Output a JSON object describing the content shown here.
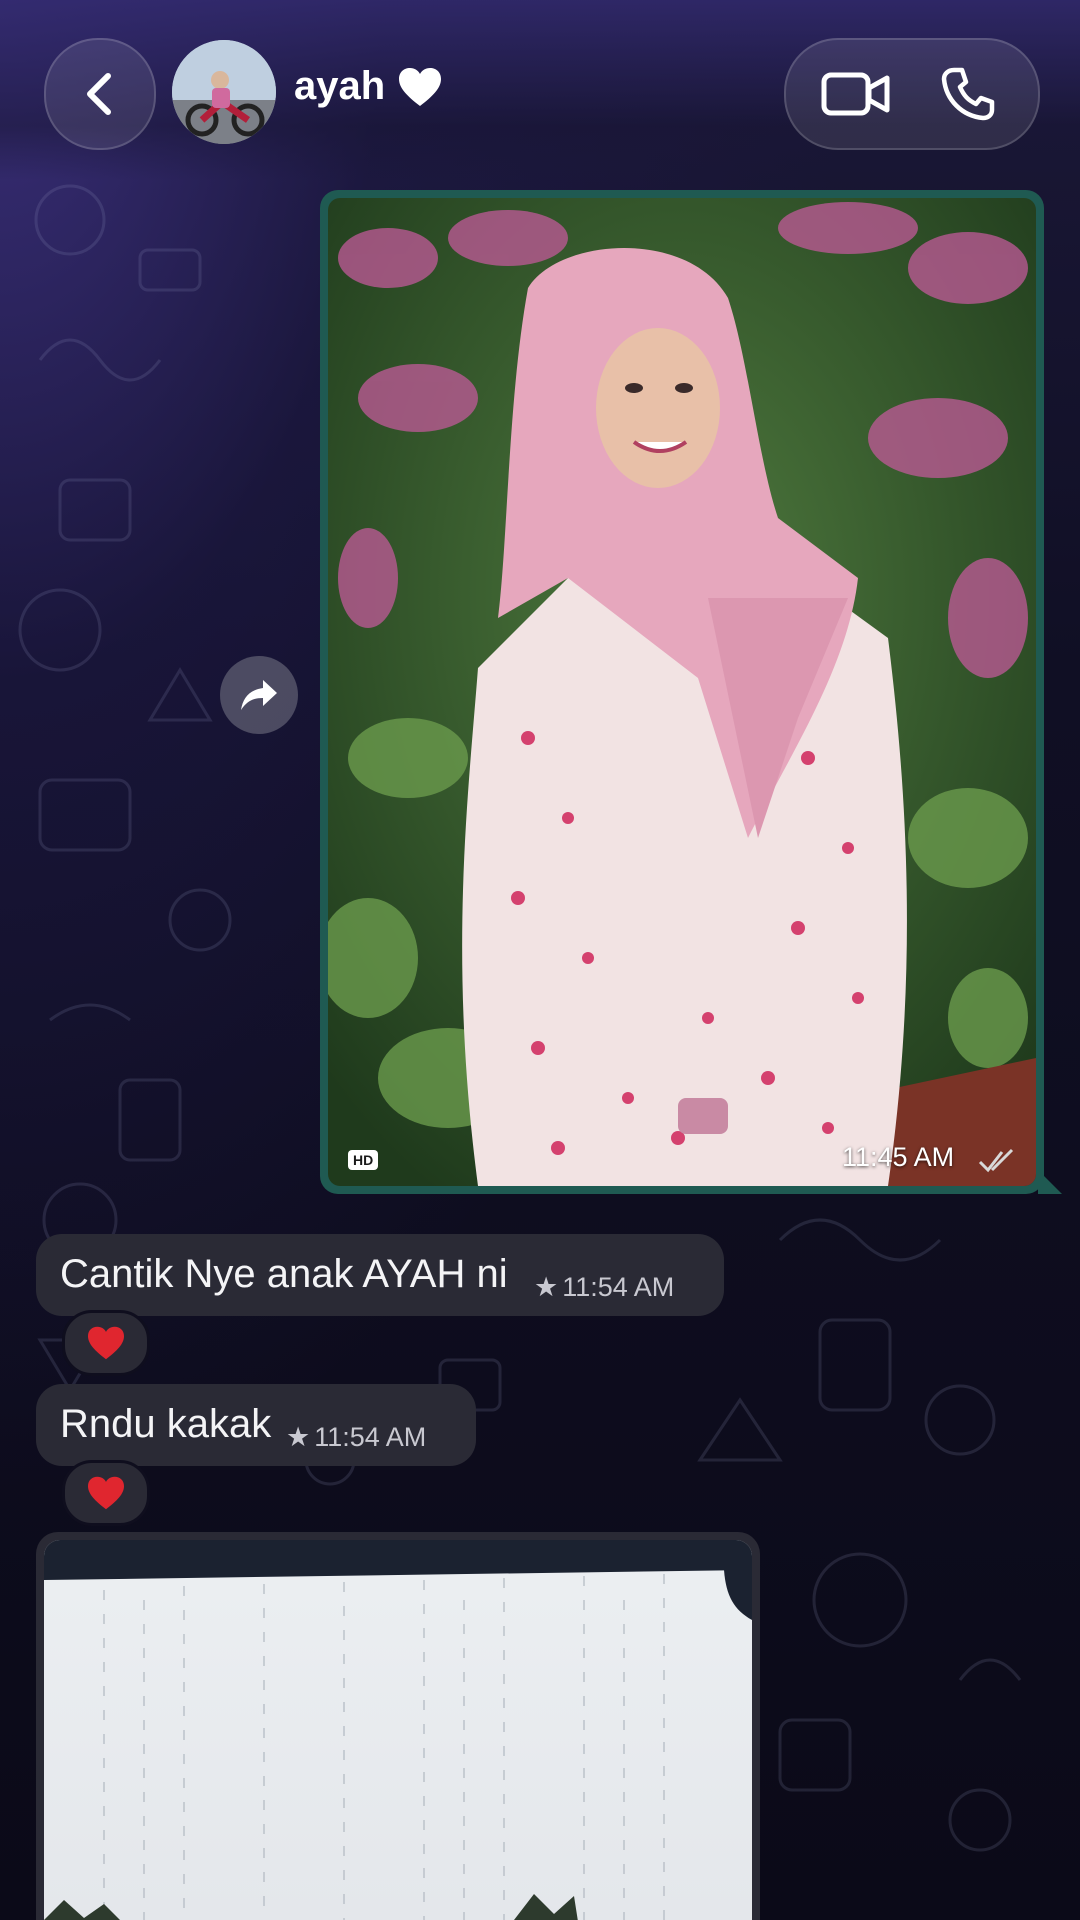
{
  "header": {
    "contact_name": "ayah",
    "back_icon": "chevron-left-icon",
    "video_icon": "video-camera-icon",
    "call_icon": "phone-icon"
  },
  "messages": {
    "photo": {
      "badge": "HD",
      "time": "11:45 AM",
      "status_icon": "double-check-icon"
    },
    "incoming": [
      {
        "text": "Cantik Nye anak AYAH ni",
        "time": "11:54 AM",
        "starred": true,
        "reaction": "red-heart"
      },
      {
        "text": "Rndu kakak",
        "time": "11:54 AM",
        "starred": true,
        "reaction": "red-heart"
      }
    ]
  },
  "colors": {
    "outgoing_bubble": "#1f5a52",
    "incoming_bubble": "#2a2a35",
    "heart": "#e0262f"
  }
}
